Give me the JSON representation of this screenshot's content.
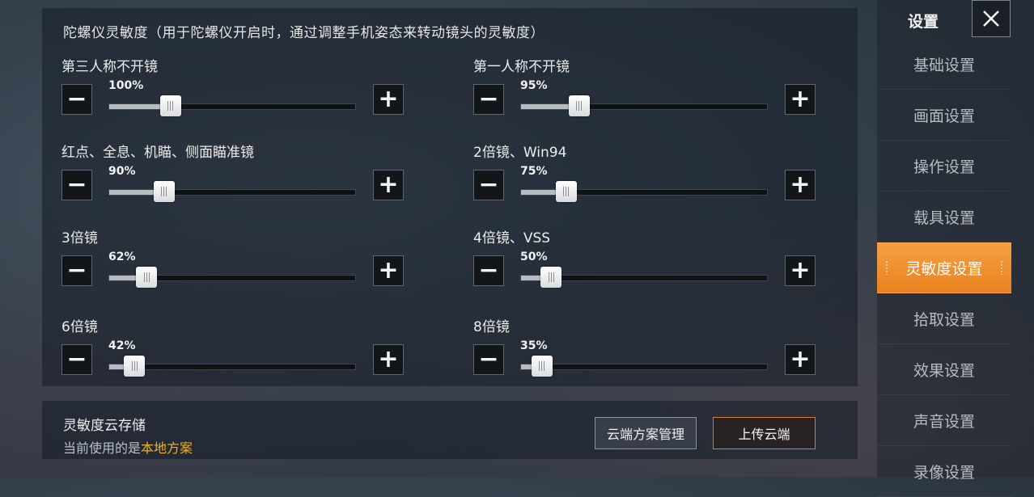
{
  "panel": {
    "title": "陀螺仪灵敏度（用于陀螺仪开启时，通过调整手机姿态来转动镜头的灵敏度）"
  },
  "rows": [
    {
      "label": "第三人称不开镜",
      "percent_text": "100%",
      "value": 0.25
    },
    {
      "label": "第一人称不开镜",
      "percent_text": "95%",
      "value": 0.237
    },
    {
      "label": "红点、全息、机瞄、侧面瞄准镜",
      "percent_text": "90%",
      "value": 0.225
    },
    {
      "label": "2倍镜、Win94",
      "percent_text": "75%",
      "value": 0.185
    },
    {
      "label": "3倍镜",
      "percent_text": "62%",
      "value": 0.155
    },
    {
      "label": "4倍镜、VSS",
      "percent_text": "50%",
      "value": 0.125
    },
    {
      "label": "6倍镜",
      "percent_text": "42%",
      "value": 0.105
    },
    {
      "label": "8倍镜",
      "percent_text": "35%",
      "value": 0.087
    }
  ],
  "icons": {
    "minus": "minus-icon",
    "plus": "plus-icon",
    "close": "close-icon"
  },
  "minus_glyph": "−",
  "plus_glyph": "+",
  "cloud": {
    "title": "灵敏度云存储",
    "sub_prefix": "当前使用的是",
    "sub_highlight": "本地方案",
    "manage_label": "云端方案管理",
    "upload_label": "上传云端"
  },
  "sidebar": {
    "title": "设置",
    "items": [
      "基础设置",
      "画面设置",
      "操作设置",
      "载具设置",
      "灵敏度设置",
      "拾取设置",
      "效果设置",
      "声音设置",
      "录像设置"
    ],
    "active_index": 4
  },
  "colors": {
    "accent": "#f0962e",
    "highlight": "#f0b21a"
  }
}
